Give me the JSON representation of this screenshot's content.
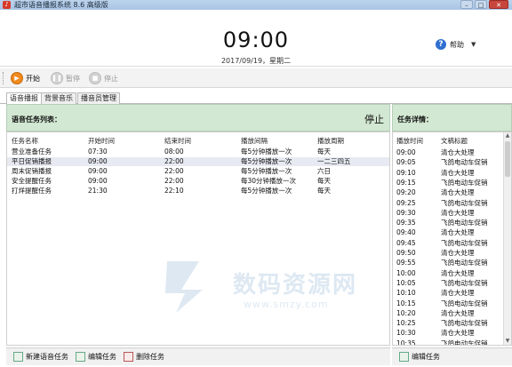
{
  "window": {
    "title": "超市语音播报系统 8.6 高级版",
    "controls": {
      "min": "–",
      "max": "□",
      "close": "✕"
    }
  },
  "header": {
    "clock": "09:00",
    "date": "2017/09/19，星期二",
    "help_label": "帮助"
  },
  "toolbar": {
    "start_label": "开始",
    "pause_label": "暂停",
    "stop_label": "停止"
  },
  "tabs": [
    {
      "label": "语音播报"
    },
    {
      "label": "背景音乐"
    },
    {
      "label": "播音员管理"
    }
  ],
  "task_panel": {
    "title": "语音任务列表：",
    "status": "停止",
    "columns": [
      "任务名称",
      "开始时间",
      "结束时间",
      "播放间隔",
      "播放周期"
    ],
    "rows": [
      [
        "营业准备任务",
        "07:30",
        "08:00",
        "每5分钟播放一次",
        "每天"
      ],
      [
        "平日促销播报",
        "09:00",
        "22:00",
        "每5分钟播放一次",
        "一二三四五"
      ],
      [
        "周末促销播报",
        "09:00",
        "22:00",
        "每5分钟播放一次",
        "六日"
      ],
      [
        "安全提醒任务",
        "09:00",
        "22:00",
        "每30分钟播放一次",
        "每天"
      ],
      [
        "打烊提醒任务",
        "21:30",
        "22:10",
        "每5分钟播放一次",
        "每天"
      ]
    ]
  },
  "detail_panel": {
    "title": "任务详情：",
    "columns": [
      "播放时间",
      "文稿标题"
    ],
    "rows": [
      [
        "09:00",
        "清仓大处理"
      ],
      [
        "09:05",
        "飞鸽电动车促销"
      ],
      [
        "09:10",
        "清仓大处理"
      ],
      [
        "09:15",
        "飞鸽电动车促销"
      ],
      [
        "09:20",
        "清仓大处理"
      ],
      [
        "09:25",
        "飞鸽电动车促销"
      ],
      [
        "09:30",
        "清仓大处理"
      ],
      [
        "09:35",
        "飞鸽电动车促销"
      ],
      [
        "09:40",
        "清仓大处理"
      ],
      [
        "09:45",
        "飞鸽电动车促销"
      ],
      [
        "09:50",
        "清仓大处理"
      ],
      [
        "09:55",
        "飞鸽电动车促销"
      ],
      [
        "10:00",
        "清仓大处理"
      ],
      [
        "10:05",
        "飞鸽电动车促销"
      ],
      [
        "10:10",
        "清仓大处理"
      ],
      [
        "10:15",
        "飞鸽电动车促销"
      ],
      [
        "10:20",
        "清仓大处理"
      ],
      [
        "10:25",
        "飞鸽电动车促销"
      ],
      [
        "10:30",
        "清仓大处理"
      ],
      [
        "10:35",
        "飞鸽电动车促销"
      ]
    ]
  },
  "footer": {
    "new_task": "新建语音任务",
    "edit_task": "编辑任务",
    "delete_task": "删除任务",
    "edit_detail": "编辑任务"
  },
  "watermark": {
    "text": "数码资源网",
    "url": "www.smzy.com"
  },
  "colors": {
    "panel_header": "#d2e8d2",
    "accent_orange": "#f08a1e",
    "help_blue": "#2f6fd0"
  }
}
